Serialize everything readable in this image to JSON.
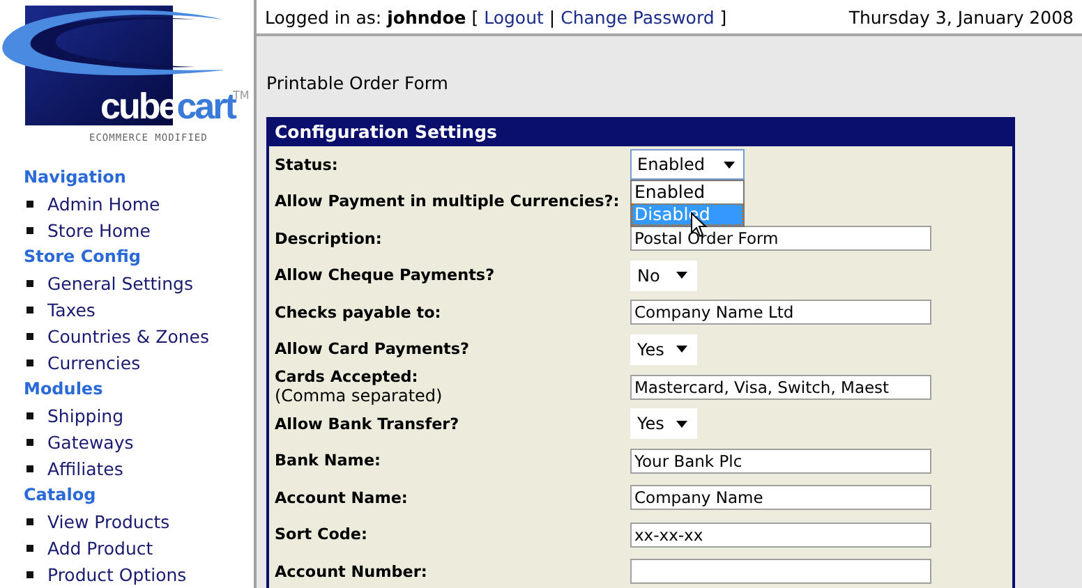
{
  "logo": {
    "word_1": "cube",
    "word_2": "cart",
    "trademark": "TM",
    "tagline": "ECOMMERCE MODIFIED"
  },
  "header": {
    "prefix": "Logged in as:",
    "user": "johndoe",
    "open_bracket": "[",
    "links": [
      "Logout",
      "Change Password"
    ],
    "separator": "|",
    "close_bracket": "]",
    "date": "Thursday 3, January 2008"
  },
  "sidebar": [
    {
      "title": "Navigation",
      "items": [
        "Admin Home",
        "Store Home"
      ]
    },
    {
      "title": "Store Config",
      "items": [
        "General Settings",
        "Taxes",
        "Countries & Zones",
        "Currencies"
      ]
    },
    {
      "title": "Modules",
      "items": [
        "Shipping",
        "Gateways",
        "Affiliates"
      ]
    },
    {
      "title": "Catalog",
      "items": [
        "View Products",
        "Add Product",
        "Product Options"
      ]
    }
  ],
  "page_title": "Printable Order Form",
  "panel": {
    "title": "Configuration Settings",
    "rows": [
      {
        "label": "Status:",
        "kind": "select",
        "value": "Enabled",
        "open": true,
        "options": [
          {
            "label": "Enabled",
            "highlighted": false
          },
          {
            "label": "Disabled",
            "highlighted": true
          }
        ]
      },
      {
        "label": "Allow Payment in multiple Currencies?:",
        "kind": "hidden"
      },
      {
        "label": "Description:",
        "kind": "text",
        "value": "Postal Order Form"
      },
      {
        "label": "Allow Cheque Payments?",
        "kind": "select",
        "value": "No",
        "open": false
      },
      {
        "label": "Checks payable to:",
        "kind": "text",
        "value": "Company Name Ltd"
      },
      {
        "label": "Allow Card Payments?",
        "kind": "select",
        "value": "Yes",
        "open": false
      },
      {
        "label": "Cards Accepted:",
        "note": "(Comma separated)",
        "kind": "text",
        "value": "Mastercard, Visa, Switch, Maest"
      },
      {
        "label": "Allow Bank Transfer?",
        "kind": "select",
        "value": "Yes",
        "open": false
      },
      {
        "label": "Bank Name:",
        "kind": "text",
        "value": "Your Bank Plc"
      },
      {
        "label": "Account Name:",
        "kind": "text",
        "value": "Company Name"
      },
      {
        "label": "Sort Code:",
        "kind": "text",
        "value": "xx-xx-xx"
      },
      {
        "label": "Account Number:",
        "kind": "text"
      }
    ]
  }
}
